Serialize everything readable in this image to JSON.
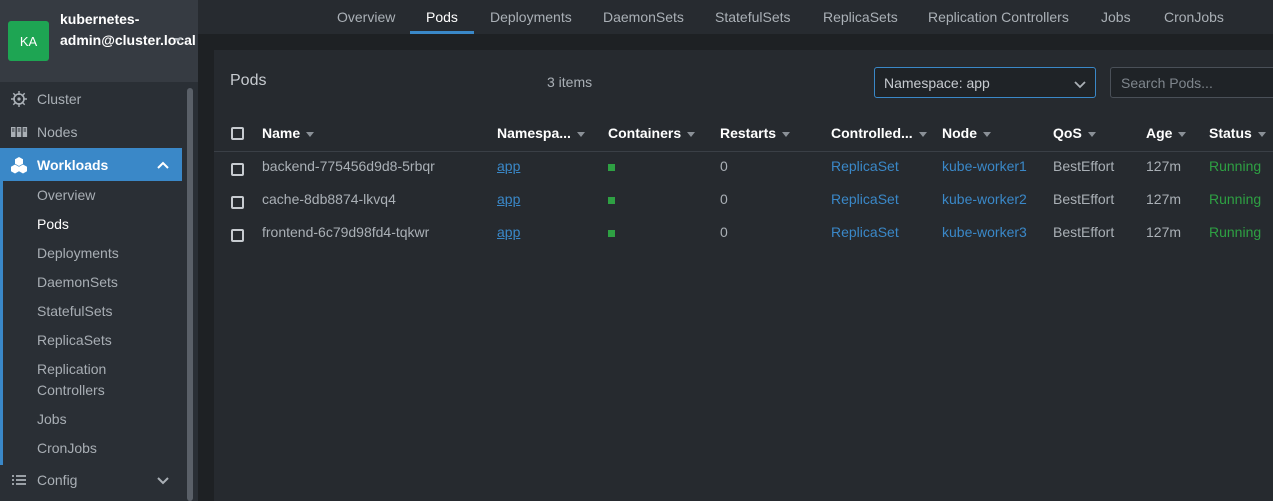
{
  "cluster": {
    "avatar": "KA",
    "name": "kubernetes-admin@cluster.local"
  },
  "sidebar": {
    "items": [
      {
        "label": "Cluster",
        "icon": "helm-icon"
      },
      {
        "label": "Nodes",
        "icon": "nodes-icon"
      },
      {
        "label": "Workloads",
        "icon": "workloads-icon"
      },
      {
        "label": "Config",
        "icon": "list-icon"
      }
    ],
    "workloads_sub": [
      "Overview",
      "Pods",
      "Deployments",
      "DaemonSets",
      "StatefulSets",
      "ReplicaSets",
      "Replication Controllers",
      "Jobs",
      "CronJobs"
    ]
  },
  "tabs": [
    "Overview",
    "Pods",
    "Deployments",
    "DaemonSets",
    "StatefulSets",
    "ReplicaSets",
    "Replication Controllers",
    "Jobs",
    "CronJobs"
  ],
  "active_tab": "Pods",
  "panel": {
    "title": "Pods",
    "count": "3 items",
    "namespace_select": "Namespace: app",
    "search_placeholder": "Search Pods..."
  },
  "table": {
    "columns": [
      "Name",
      "Namespa...",
      "Containers",
      "Restarts",
      "Controlled...",
      "Node",
      "QoS",
      "Age",
      "Status"
    ],
    "rows": [
      {
        "name": "backend-775456d9d8-5rbqr",
        "namespace": "app",
        "restarts": "0",
        "controlled_by": "ReplicaSet",
        "node": "kube-worker1",
        "qos": "BestEffort",
        "age": "127m",
        "status": "Running"
      },
      {
        "name": "cache-8db8874-lkvq4",
        "namespace": "app",
        "restarts": "0",
        "controlled_by": "ReplicaSet",
        "node": "kube-worker2",
        "qos": "BestEffort",
        "age": "127m",
        "status": "Running"
      },
      {
        "name": "frontend-6c79d98fd4-tqkwr",
        "namespace": "app",
        "restarts": "0",
        "controlled_by": "ReplicaSet",
        "node": "kube-worker3",
        "qos": "BestEffort",
        "age": "127m",
        "status": "Running"
      }
    ]
  },
  "colors": {
    "accent": "#3a88c8",
    "running": "#2ea043",
    "avatar": "#1ea553"
  }
}
